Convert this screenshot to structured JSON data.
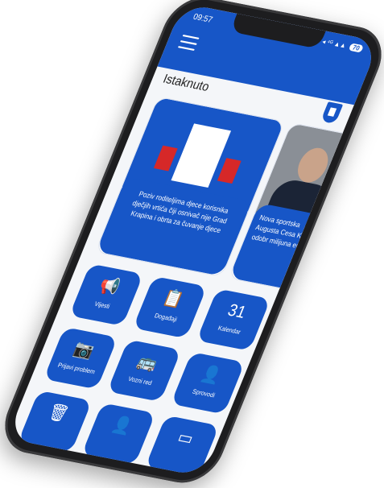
{
  "status": {
    "time": "09:57",
    "battery": "70"
  },
  "header": {
    "title": "Istaknuto"
  },
  "cards": [
    {
      "caption": "Poziv roditeljima djece korisnika dječjih vrtića čiji osnivač nije Grad Krapina i obrta za čuvanje djece"
    },
    {
      "caption": "Nova sportska Augusta Cesa Krapini odobr milijuna eura"
    }
  ],
  "tiles": [
    {
      "label": "Vijesti",
      "icon": "megaphone-icon",
      "glyph": "📢"
    },
    {
      "label": "Događaji",
      "icon": "clipboard-icon",
      "glyph": "📋"
    },
    {
      "label": "Kalendar",
      "icon": "calendar-icon",
      "glyph": "31"
    },
    {
      "label": "Prijavi problem",
      "icon": "camera-icon",
      "glyph": "📷"
    },
    {
      "label": "Vozni red",
      "icon": "bus-icon",
      "glyph": "🚌"
    },
    {
      "label": "Sprovodi",
      "icon": "portrait-icon",
      "glyph": "👤"
    },
    {
      "label": "",
      "icon": "trash-icon",
      "glyph": "🗑"
    },
    {
      "label": "",
      "icon": "person-icon",
      "glyph": "👤"
    },
    {
      "label": "",
      "icon": "card-icon",
      "glyph": "▭"
    }
  ]
}
